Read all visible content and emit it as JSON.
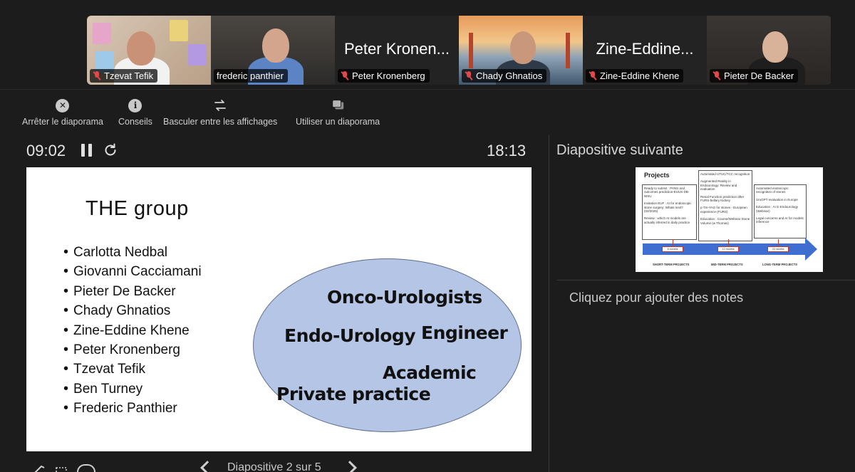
{
  "participants": [
    {
      "name": "Tzevat Tefik",
      "muted": true,
      "video": true
    },
    {
      "name": "frederic panthier",
      "muted": false,
      "video": true,
      "active": true
    },
    {
      "name": "Peter Kronenberg",
      "display_name": "Peter Kronen...",
      "muted": true,
      "video": false
    },
    {
      "name": "Chady Ghnatios",
      "muted": true,
      "video": true
    },
    {
      "name": "Zine-Eddine Khene",
      "display_name": "Zine-Eddine...",
      "muted": true,
      "video": false
    },
    {
      "name": "Pieter De Backer",
      "muted": true,
      "video": true
    }
  ],
  "toolbar": {
    "stop_label": "Arrêter le diaporama",
    "tips_label": "Conseils",
    "switch_label": "Basculer entre les affichages",
    "use_label": "Utiliser un diaporama",
    "stop_icon": "close-circle-icon",
    "tips_icon": "info-circle-icon",
    "switch_icon": "swap-arrows-icon",
    "use_icon": "stacked-slides-icon"
  },
  "presenter": {
    "elapsed": "09:02",
    "clock": "18:13"
  },
  "slide": {
    "title": "THE  group",
    "members": [
      "Carlotta Nedbal",
      "Giovanni Cacciamani",
      "Pieter De Backer",
      "Chady Ghnatios",
      "Zine-Eddine Khene",
      "Peter Kronenberg",
      "Tzevat Tefik",
      "Ben Turney",
      "Frederic Panthier"
    ],
    "ellipse_labels": {
      "onco": "Onco-Urologists",
      "endo": "Endo-Urology",
      "engineer": "Engineer",
      "academic": "Academic",
      "private": "Private practice"
    }
  },
  "next_slide": {
    "heading": "Diapositive suivante",
    "title": "Projects",
    "col1": [
      "Ready to submit : PANS and outcomes prediction-EUUS DB-WSU",
      "Invitation EUF : AI for endoscopic stone surgery: Whats next? (02/2025)",
      "Review : which AI models are actually inferred in daily practice"
    ],
    "col2": [
      "Automated UTUC/TCC recognition",
      "Augmented Reality in Endourology: Review and evaluation",
      "Renal Function prediction after FURS-bellary Kidney",
      "p-Tm-YAG for stones - European experience (FURS)",
      "Education : Course/Webinar Stone Volume (w Thomas)"
    ],
    "col3": [
      "Automated endoscopic recognition of stones",
      "UroGPT evaluation in Europe",
      "Education : AI in Endourology (Webinar)",
      "Legal concerns and AI for models inference"
    ],
    "timeline": [
      "6 months",
      "12 months",
      "24 months"
    ],
    "phases": [
      "SHORT-TERM PROJECTS",
      "MID-TERM PROJECTS",
      "LONG-TERM PROJECTS"
    ]
  },
  "notes": {
    "placeholder": "Cliquez pour ajouter des notes"
  },
  "bottom": {
    "slide_counter": "Diapositive 2 sur 5"
  }
}
